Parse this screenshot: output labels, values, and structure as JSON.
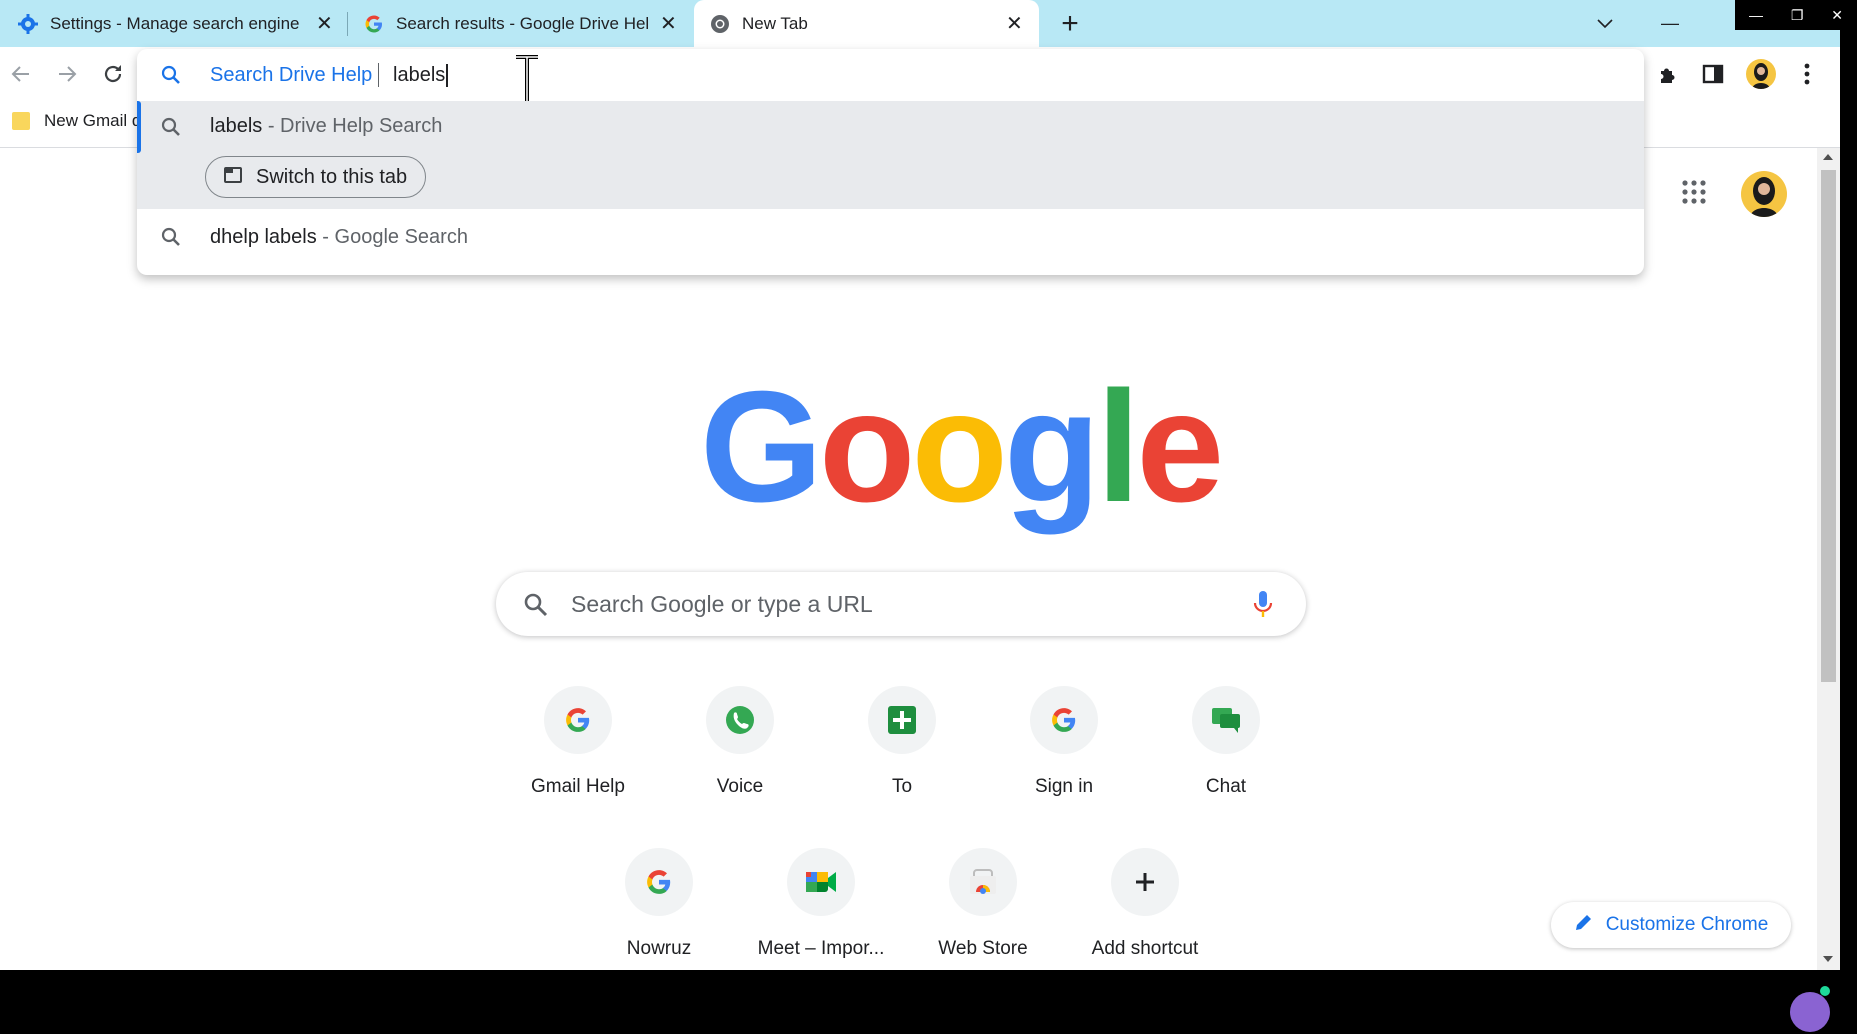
{
  "tabs": [
    {
      "title": "Settings - Manage search engine",
      "icon": "gear-icon"
    },
    {
      "title": "Search results - Google Drive Hel",
      "icon": "google-g-icon"
    },
    {
      "title": "New Tab",
      "icon": "chrome-icon"
    }
  ],
  "bookmarks": {
    "item_label": "New Gmail d"
  },
  "omnibox": {
    "keyword": "Search Drive Help",
    "query": "labels",
    "suggestions": [
      {
        "text": "labels",
        "desc": " - Drive Help Search"
      },
      {
        "text": "dhelp labels",
        "desc": " - Google Search"
      }
    ],
    "switch_tab_label": "Switch to this tab"
  },
  "search": {
    "placeholder": "Search Google or type a URL"
  },
  "shortcuts": [
    {
      "label": "Gmail Help",
      "icon": "google-g-icon"
    },
    {
      "label": "Voice",
      "icon": "voice-icon"
    },
    {
      "label": "To",
      "icon": "sheets-plus-icon"
    },
    {
      "label": "Sign in",
      "icon": "google-g-icon"
    },
    {
      "label": "Chat",
      "icon": "chat-icon"
    },
    {
      "label": "Nowruz",
      "icon": "google-g-icon"
    },
    {
      "label": "Meet – Impor...",
      "icon": "meet-icon"
    },
    {
      "label": "Web Store",
      "icon": "webstore-icon"
    },
    {
      "label": "Add shortcut",
      "icon": "plus-icon"
    }
  ],
  "customize_label": "Customize Chrome",
  "colors": {
    "blue": "#4285F4",
    "red": "#EA4335",
    "yellow": "#FBBC05",
    "green": "#34A853",
    "tabstrip": "#b8e8f5"
  }
}
